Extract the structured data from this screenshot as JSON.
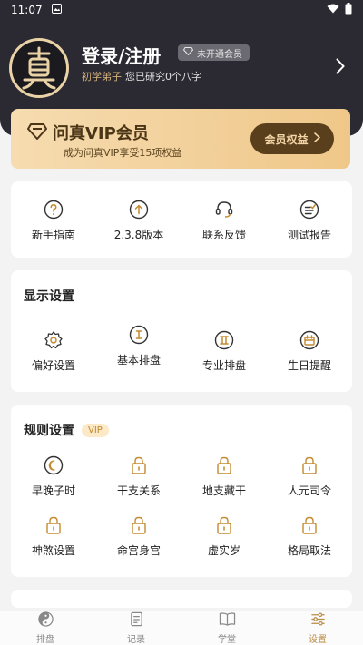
{
  "status_bar": {
    "time": "11:07"
  },
  "user": {
    "name": "登录/注册",
    "member_badge": "未开通会员",
    "level": "初学弟子",
    "summary": "您已研究0个八字"
  },
  "vip": {
    "title": "问真VIP会员",
    "subtitle": "成为问真VIP享受15项权益",
    "button_label": "会员权益"
  },
  "quick_links": [
    {
      "label": "新手指南",
      "icon": "question-icon"
    },
    {
      "label": "2.3.8版本",
      "icon": "upload-icon"
    },
    {
      "label": "联系反馈",
      "icon": "headset-icon"
    },
    {
      "label": "测试报告",
      "icon": "report-icon"
    }
  ],
  "display_settings": {
    "title": "显示设置",
    "items": [
      {
        "label": "偏好设置",
        "icon": "gear-icon"
      },
      {
        "label": "基本排盘",
        "icon": "chart-basic-icon"
      },
      {
        "label": "专业排盘",
        "icon": "chart-pro-icon"
      },
      {
        "label": "生日提醒",
        "icon": "calendar-icon"
      }
    ]
  },
  "rule_settings": {
    "title": "规则设置",
    "tag": "VIP",
    "items": [
      {
        "label": "早晚子时",
        "icon": "moon-icon"
      },
      {
        "label": "干支关系",
        "icon": "lock-icon"
      },
      {
        "label": "地支藏干",
        "icon": "lock-icon"
      },
      {
        "label": "人元司令",
        "icon": "lock-icon"
      },
      {
        "label": "神煞设置",
        "icon": "lock-icon"
      },
      {
        "label": "命宫身宫",
        "icon": "lock-icon"
      },
      {
        "label": "虚实岁",
        "icon": "lock-icon"
      },
      {
        "label": "格局取法",
        "icon": "lock-icon"
      }
    ]
  },
  "tabbar": [
    {
      "label": "排盘",
      "icon": "yinyang-icon",
      "active": false
    },
    {
      "label": "记录",
      "icon": "note-icon",
      "active": false
    },
    {
      "label": "学堂",
      "icon": "book-icon",
      "active": false
    },
    {
      "label": "设置",
      "icon": "sliders-icon",
      "active": true
    }
  ],
  "colors": {
    "header_bg": "#2b2a33",
    "accent_gold": "#b98c46",
    "vip_gradient_start": "#f6dcb0",
    "vip_gradient_end": "#efc789",
    "vip_button_bg": "#5a3f1c"
  }
}
